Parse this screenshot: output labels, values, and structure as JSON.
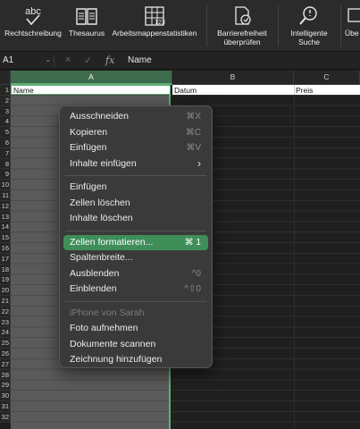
{
  "ribbon": {
    "buttons": [
      {
        "label": "Rechtschreibung",
        "icon": "spellcheck-abc-icon"
      },
      {
        "label": "Thesaurus",
        "icon": "thesaurus-book-icon"
      },
      {
        "label": "Arbeitsmappenstatistiken",
        "icon": "workbook-stats-icon"
      },
      {
        "label": "Barrierefreiheit überprüfen",
        "icon": "accessibility-check-icon"
      },
      {
        "label": "Intelligente Suche",
        "icon": "smart-lookup-icon"
      },
      {
        "label": "Übe",
        "icon": "translate-icon"
      }
    ],
    "spell_icon_text": "abc"
  },
  "formula_bar": {
    "name_box": "A1",
    "cancel_symbol": "×",
    "enter_symbol": "✓",
    "fx": "fx",
    "content": "Name"
  },
  "columns": [
    {
      "id": "A",
      "selected": true
    },
    {
      "id": "B",
      "selected": false
    },
    {
      "id": "C",
      "selected": false
    }
  ],
  "rows": [
    "1",
    "2",
    "3",
    "4",
    "5",
    "6",
    "7",
    "8",
    "9",
    "10",
    "11",
    "12",
    "13",
    "14",
    "15",
    "16",
    "17",
    "18",
    "19",
    "20",
    "21",
    "22",
    "23",
    "24",
    "25",
    "26",
    "27",
    "28",
    "29",
    "30",
    "31",
    "32"
  ],
  "cells": {
    "A1": "Name",
    "B1": "Datum",
    "C1": "Preis"
  },
  "context_menu": {
    "items": [
      {
        "label": "Ausschneiden",
        "shortcut": "⌘X"
      },
      {
        "label": "Kopieren",
        "shortcut": "⌘C"
      },
      {
        "label": "Einfügen",
        "shortcut": "⌘V"
      },
      {
        "label": "Inhalte einfügen",
        "shortcut": "›"
      },
      {
        "separator": true
      },
      {
        "label": "Einfügen",
        "shortcut": ""
      },
      {
        "label": "Zellen löschen",
        "shortcut": ""
      },
      {
        "label": "Inhalte löschen",
        "shortcut": ""
      },
      {
        "separator": true
      },
      {
        "label": "Zellen formatieren...",
        "shortcut": "⌘ 1",
        "highlighted": true
      },
      {
        "label": "Spaltenbreite...",
        "shortcut": ""
      },
      {
        "label": "Ausblenden",
        "shortcut": "^0"
      },
      {
        "label": "Einblenden",
        "shortcut": "^⇧0"
      },
      {
        "separator": true
      },
      {
        "label": "iPhone von Sarah",
        "shortcut": "",
        "disabled": true
      },
      {
        "label": "Foto aufnehmen",
        "shortcut": ""
      },
      {
        "label": "Dokumente scannen",
        "shortcut": ""
      },
      {
        "label": "Zeichnung hinzufügen",
        "shortcut": ""
      }
    ]
  },
  "colors": {
    "accent_green": "#3f8e5a",
    "selection_border": "#5fae72"
  }
}
